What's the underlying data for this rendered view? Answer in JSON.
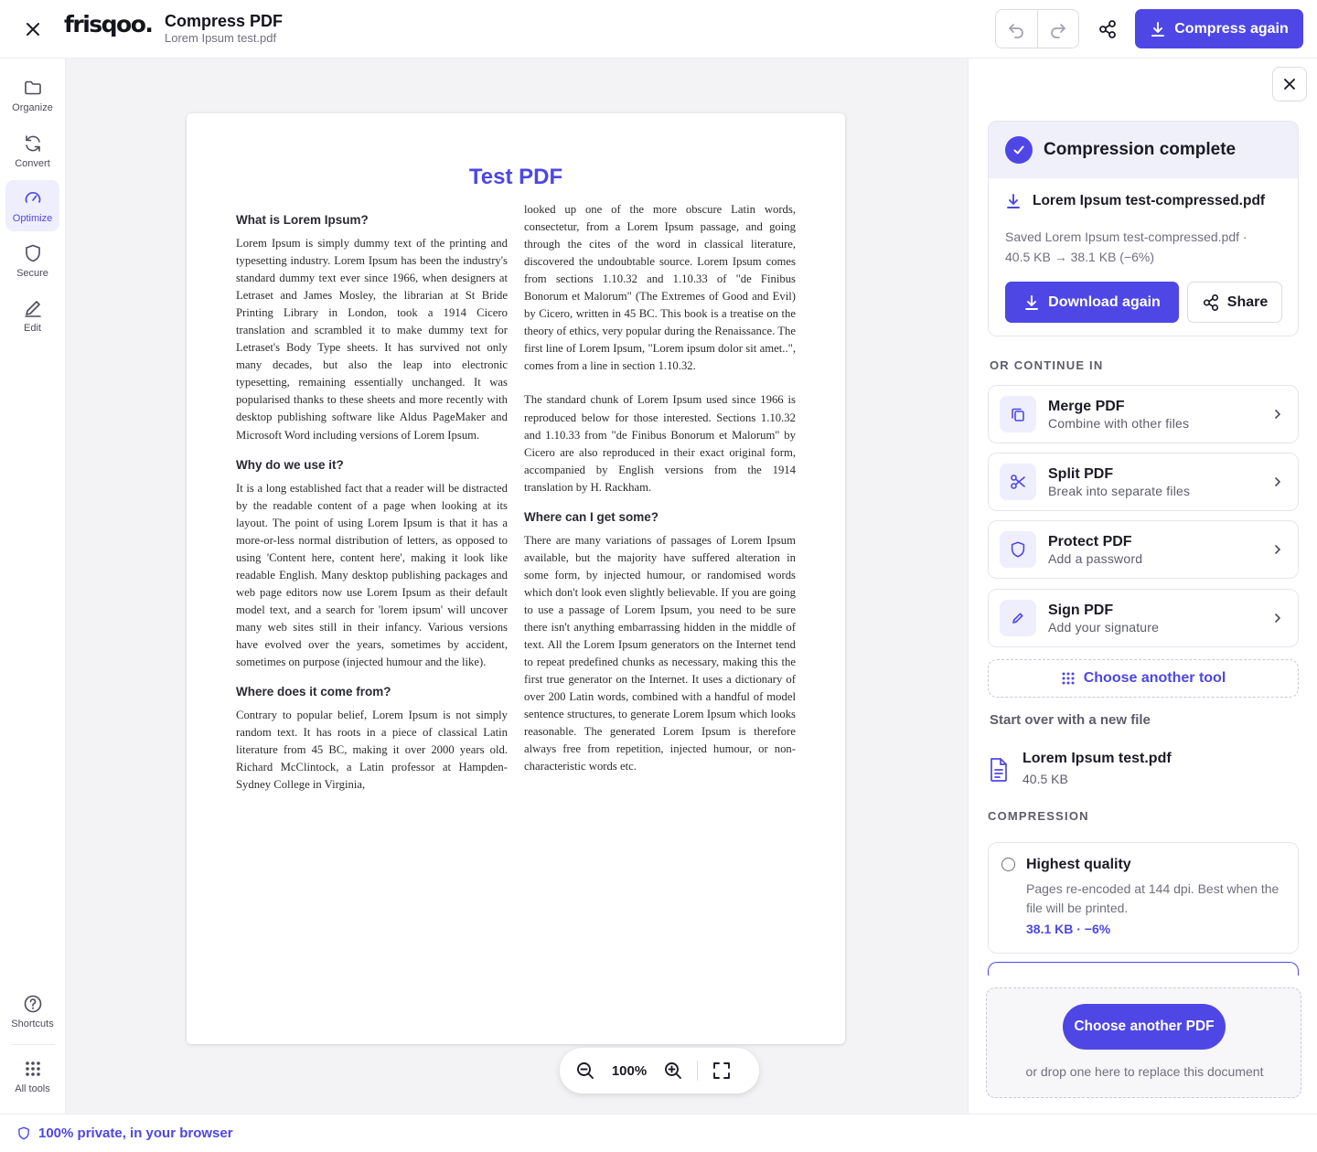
{
  "header": {
    "logo": "frisqoo.",
    "title": "Compress PDF",
    "filename": "Lorem Ipsum test.pdf",
    "compress_again": "Compress again"
  },
  "sidebar": {
    "items": [
      {
        "label": "Organize",
        "icon": "folder-icon"
      },
      {
        "label": "Convert",
        "icon": "refresh-icon"
      },
      {
        "label": "Optimize",
        "icon": "gauge-icon",
        "active": true
      },
      {
        "label": "Secure",
        "icon": "shield-icon"
      },
      {
        "label": "Edit",
        "icon": "pencil-icon"
      }
    ],
    "bottom": [
      {
        "label": "Shortcuts",
        "icon": "help-circle-icon"
      },
      {
        "label": "All tools",
        "icon": "grid-icon"
      }
    ]
  },
  "document": {
    "title": "Test PDF",
    "left_column": [
      {
        "heading": "What is Lorem Ipsum?",
        "text": "Lorem Ipsum is simply dummy text of the printing and typesetting industry. Lorem Ipsum has been the industry's standard dummy text ever since 1966, when designers at Letraset and James Mosley, the librarian at St Bride Printing Library in London, took a 1914 Cicero translation and scrambled it to make dummy text for Letraset's Body Type sheets. It has survived not only many decades, but also the leap into electronic typesetting, remaining essentially unchanged. It was popularised thanks to these sheets and more recently with desktop publishing software like Aldus PageMaker and Microsoft Word including versions of Lorem Ipsum."
      },
      {
        "heading": "Why do we use it?",
        "text": "It is a long established fact that a reader will be distracted by the readable content of a page when looking at its layout. The point of using Lorem Ipsum is that it has a more-or-less normal distribution of letters, as opposed to using 'Content here, content here', making it look like readable English. Many desktop publishing packages and web page editors now use Lorem Ipsum as their default model text, and a search for 'lorem ipsum' will uncover many web sites still in their infancy. Various versions have evolved over the years, sometimes by accident, sometimes on purpose (injected humour and the like)."
      },
      {
        "heading": "Where does it come from?",
        "text": "Contrary to popular belief, Lorem Ipsum is not simply random text. It has roots in a piece of classical Latin literature from 45 BC, making it over 2000 years old. Richard McClintock, a Latin professor at Hampden-Sydney College in Virginia,"
      }
    ],
    "right_column": [
      {
        "heading": "",
        "text": "looked up one of the more obscure Latin words, consectetur, from a Lorem Ipsum passage, and going through the cites of the word in classical literature, discovered the undoubtable source. Lorem Ipsum comes from sections 1.10.32 and 1.10.33 of \"de Finibus Bonorum et Malorum\" (The Extremes of Good and Evil) by Cicero, written in 45 BC. This book is a treatise on the theory of ethics, very popular during the Renaissance. The first line of Lorem Ipsum, \"Lorem ipsum dolor sit amet..\", comes from a line in section 1.10.32."
      },
      {
        "heading": "",
        "text": "The standard chunk of Lorem Ipsum used since 1966 is reproduced below for those interested. Sections 1.10.32 and 1.10.33 from \"de Finibus Bonorum et Malorum\" by Cicero are also reproduced in their exact original form, accompanied by English versions from the 1914 translation by H. Rackham."
      },
      {
        "heading": "Where can I get some?",
        "text": "There are many variations of passages of Lorem Ipsum available, but the majority have suffered alteration in some form, by injected humour, or randomised words which don't look even slightly believable. If you are going to use a passage of Lorem Ipsum, you need to be sure there isn't anything embarrassing hidden in the middle of text. All the Lorem Ipsum generators on the Internet tend to repeat predefined chunks as necessary, making this the first true generator on the Internet. It uses a dictionary of over 200 Latin words, combined with a handful of model sentence structures, to generate Lorem Ipsum which looks reasonable. The generated Lorem Ipsum is therefore always free from repetition, injected humour, or non-characteristic words etc."
      }
    ]
  },
  "zoom": {
    "level": "100%"
  },
  "panel": {
    "result": {
      "title": "Compression complete",
      "file": "Lorem Ipsum test-compressed.pdf",
      "saved_line1": "Saved Lorem Ipsum test-compressed.pdf ·",
      "saved_line2": "40.5 KB → 38.1 KB (−6%)",
      "download_again": "Download again",
      "share": "Share"
    },
    "continue_label": "OR CONTINUE IN",
    "tools": [
      {
        "name": "Merge PDF",
        "desc": "Combine with other files",
        "icon": "merge-icon"
      },
      {
        "name": "Split PDF",
        "desc": "Break into separate files",
        "icon": "scissors-icon"
      },
      {
        "name": "Protect PDF",
        "desc": "Add a password",
        "icon": "shield-icon"
      },
      {
        "name": "Sign PDF",
        "desc": "Add your signature",
        "icon": "pen-icon"
      }
    ],
    "choose_tool": "Choose another tool",
    "start_over": "Start over with a new file",
    "original": {
      "name": "Lorem Ipsum test.pdf",
      "size": "40.5 KB"
    },
    "compression_label": "COMPRESSION",
    "option": {
      "name": "Highest quality",
      "desc": "Pages re-encoded at 144 dpi. Best when the file will be printed.",
      "meta": "38.1 KB · −6%"
    },
    "dropzone": {
      "button": "Choose another PDF",
      "hint": "or drop one here to replace this document"
    }
  },
  "footer": {
    "privacy": "100% private, in your browser"
  },
  "colors": {
    "accent": "#4e47e5",
    "accent_soft": "#efeefc",
    "canvas": "#f3f3f6"
  }
}
